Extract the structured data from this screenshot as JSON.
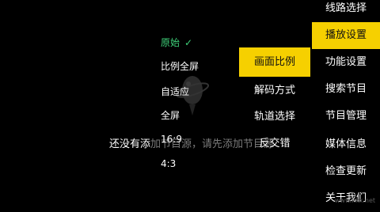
{
  "empty_hint": {
    "prefix": "还没有添",
    "suffix": "加节目源，请先添加节目源"
  },
  "aspect_options": [
    {
      "label": "原始",
      "selected": true
    },
    {
      "label": "比例全屏",
      "selected": false
    },
    {
      "label": "自适应",
      "selected": false
    },
    {
      "label": "全屏",
      "selected": false
    },
    {
      "label": "16:9",
      "selected": false
    },
    {
      "label": "4:3",
      "selected": false
    }
  ],
  "playback_submenu": [
    {
      "label": "画面比例",
      "active": true
    },
    {
      "label": "解码方式",
      "active": false
    },
    {
      "label": "轨道选择",
      "active": false
    },
    {
      "label": "反交错",
      "active": false
    }
  ],
  "main_menu": [
    {
      "label": "线路选择",
      "active": false
    },
    {
      "label": "播放设置",
      "active": true
    },
    {
      "label": "功能设置",
      "active": false
    },
    {
      "label": "搜索节目",
      "active": false
    },
    {
      "label": "节目管理",
      "active": false
    },
    {
      "label": "媒体信息",
      "active": false
    },
    {
      "label": "检查更新",
      "active": false
    },
    {
      "label": "关于我们",
      "active": false
    }
  ],
  "watermark": "www.kkx.net",
  "colors": {
    "accent": "#f6d000",
    "selected": "#3fd27a",
    "background": "#000000"
  },
  "icons": {
    "selected_mark": "checkmark-icon",
    "background": "planet-logo"
  }
}
